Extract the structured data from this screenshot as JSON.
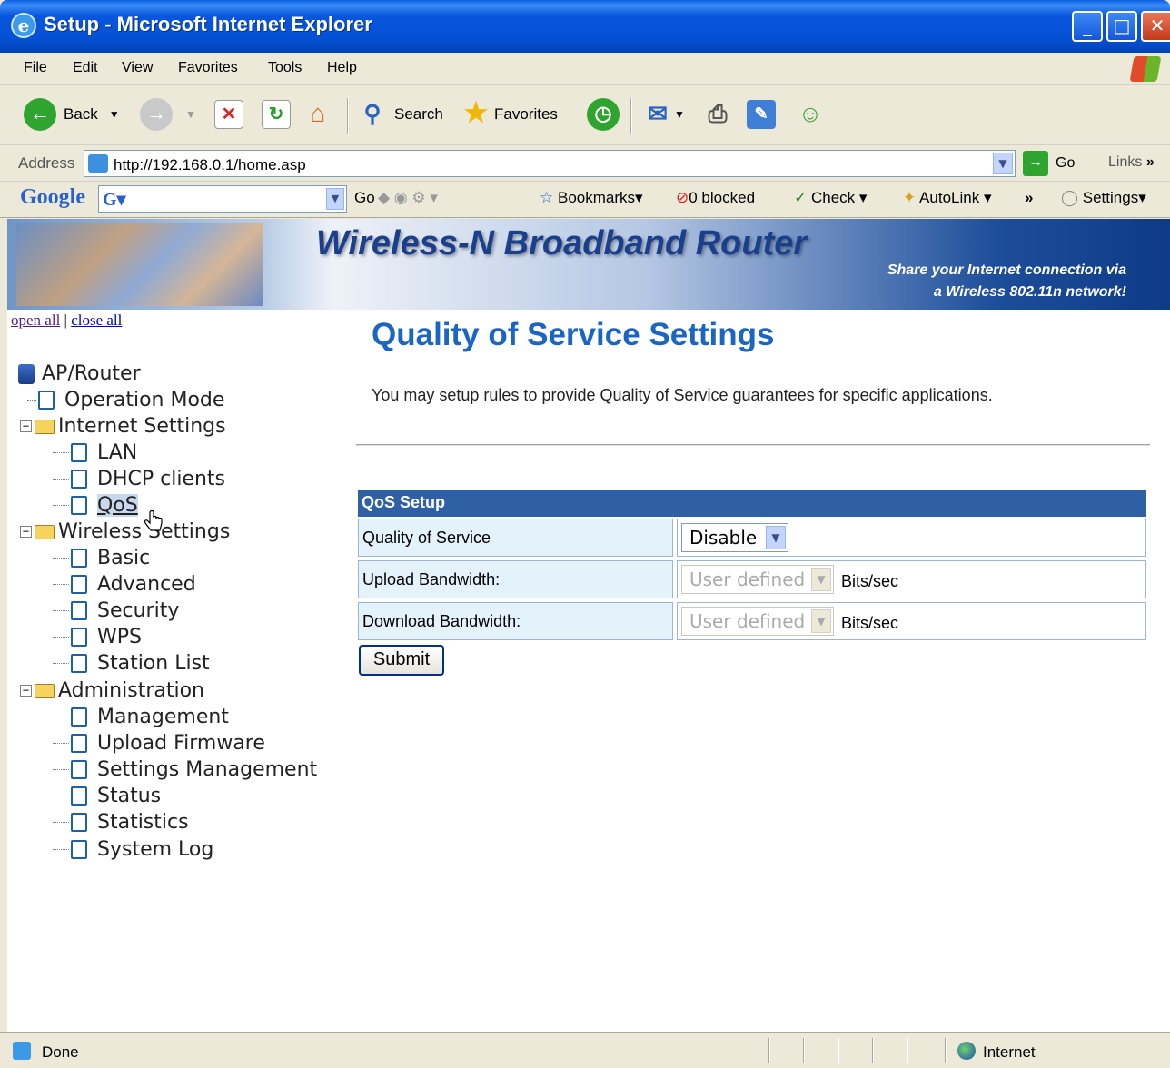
{
  "window": {
    "title": "Setup - Microsoft Internet Explorer"
  },
  "menu": [
    "File",
    "Edit",
    "View",
    "Favorites",
    "Tools",
    "Help"
  ],
  "toolbar": {
    "back": "Back",
    "search": "Search",
    "favorites": "Favorites"
  },
  "address": {
    "label": "Address",
    "url": "http://192.168.0.1/home.asp",
    "go": "Go",
    "links": "Links"
  },
  "googlebar": {
    "logo": "Google",
    "go": "Go",
    "bookmarks": "Bookmarks",
    "blocked": "0 blocked",
    "check": "Check",
    "autolink": "AutoLink",
    "settings": "Settings"
  },
  "banner": {
    "title": "Wireless-N Broadband Router",
    "sub1": "Share your Internet connection via",
    "sub2": "a Wireless 802.11n network!"
  },
  "tree": {
    "open_all": "open all",
    "close_all": "close all",
    "root": "AP/Router",
    "items": [
      "Operation Mode",
      "Internet Settings",
      "LAN",
      "DHCP clients",
      "QoS",
      "Wireless Settings",
      "Basic",
      "Advanced",
      "Security",
      "WPS",
      "Station List",
      "Administration",
      "Management",
      "Upload Firmware",
      "Settings Management",
      "Status",
      "Statistics",
      "System Log"
    ]
  },
  "main": {
    "title": "Quality of Service Settings",
    "description": "You may setup rules to provide Quality of Service guarantees for specific applications.",
    "table_header": "QoS Setup",
    "rows": [
      {
        "label": "Quality of Service",
        "value": "Disable"
      },
      {
        "label": "Upload Bandwidth:",
        "value": "User defined",
        "unit": "Bits/sec"
      },
      {
        "label": "Download Bandwidth:",
        "value": "User defined",
        "unit": "Bits/sec"
      }
    ],
    "submit": "Submit"
  },
  "status": {
    "text": "Done",
    "zone": "Internet"
  }
}
